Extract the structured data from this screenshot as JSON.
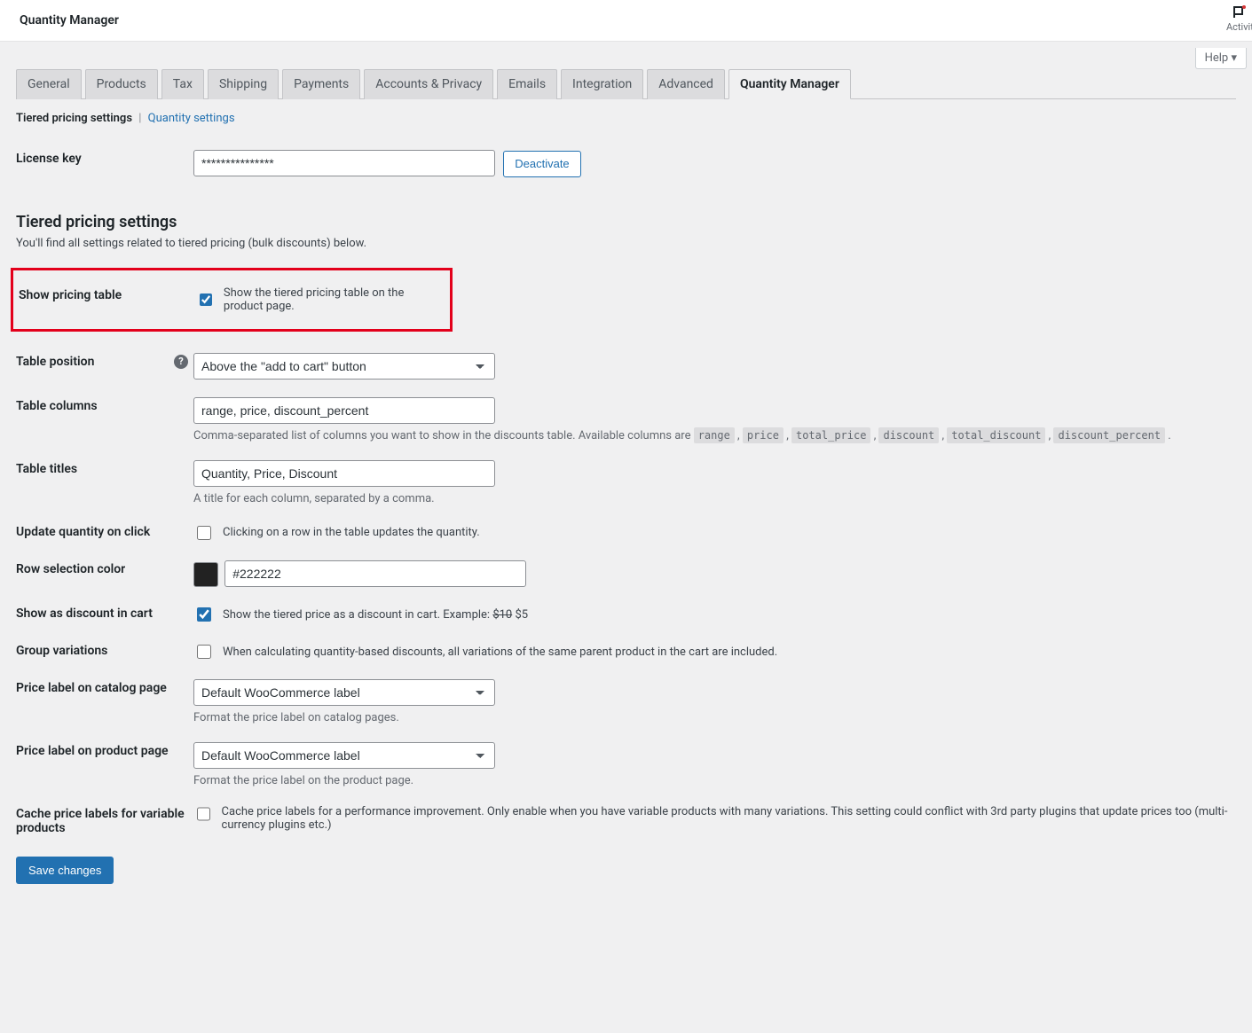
{
  "header": {
    "page_title": "Quantity Manager",
    "activity_label": "Activit",
    "help_label": "Help"
  },
  "tabs": [
    {
      "label": "General"
    },
    {
      "label": "Products"
    },
    {
      "label": "Tax"
    },
    {
      "label": "Shipping"
    },
    {
      "label": "Payments"
    },
    {
      "label": "Accounts & Privacy"
    },
    {
      "label": "Emails"
    },
    {
      "label": "Integration"
    },
    {
      "label": "Advanced"
    },
    {
      "label": "Quantity Manager",
      "active": true
    }
  ],
  "subsub": {
    "current": "Tiered pricing settings",
    "other": "Quantity settings"
  },
  "license": {
    "label": "License key",
    "value": "***************",
    "deactivate": "Deactivate"
  },
  "section": {
    "heading": "Tiered pricing settings",
    "desc": "You'll find all settings related to tiered pricing (bulk discounts) below."
  },
  "show_pricing_table": {
    "label": "Show pricing table",
    "checkbox_label": "Show the tiered pricing table on the product page.",
    "checked": true
  },
  "table_position": {
    "label": "Table position",
    "value": "Above the \"add to cart\" button"
  },
  "table_columns": {
    "label": "Table columns",
    "value": "range, price, discount_percent",
    "desc": "Comma-separated list of columns you want to show in the discounts table. Available columns are ",
    "tags": [
      "range",
      "price",
      "total_price",
      "discount",
      "total_discount",
      "discount_percent"
    ]
  },
  "table_titles": {
    "label": "Table titles",
    "value": "Quantity, Price, Discount",
    "desc": "A title for each column, separated by a comma."
  },
  "update_qty": {
    "label": "Update quantity on click",
    "checkbox_label": "Clicking on a row in the table updates the quantity.",
    "checked": false
  },
  "row_color": {
    "label": "Row selection color",
    "value": "#222222"
  },
  "discount_in_cart": {
    "label": "Show as discount in cart",
    "checkbox_label_prefix": "Show the tiered price as a discount in cart. Example: ",
    "strike": "$10",
    "after": " $5",
    "checked": true
  },
  "group_variations": {
    "label": "Group variations",
    "checkbox_label": "When calculating quantity-based discounts, all variations of the same parent product in the cart are included.",
    "checked": false
  },
  "catalog_label": {
    "label": "Price label on catalog page",
    "value": "Default WooCommerce label",
    "desc": "Format the price label on catalog pages."
  },
  "product_label": {
    "label": "Price label on product page",
    "value": "Default WooCommerce label",
    "desc": "Format the price label on the product page."
  },
  "cache_labels": {
    "label": "Cache price labels for variable products",
    "checkbox_label": "Cache price labels for a performance improvement. Only enable when you have variable products with many variations. This setting could conflict with 3rd party plugins that update prices too (multi-currency plugins etc.)",
    "checked": false
  },
  "save": "Save changes"
}
